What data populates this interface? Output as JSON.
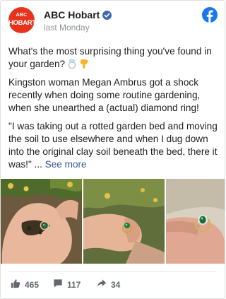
{
  "post": {
    "page_name": "ABC Hobart",
    "avatar": {
      "line1": "ABC",
      "line2": "HOBART"
    },
    "timestamp": "last Monday",
    "text": {
      "question": "What's the most surprising thing you've found in your garden?",
      "story": "Kingston woman Megan Ambrus got a shock recently when doing some routine gardening, when she unearthed a (actual) diamond ring!",
      "quote": "\"I was taking out a rotted garden bed and moving the soil to use elsewhere and when I dug down into the original clay soil beneath the bed, there it was!\" ...",
      "see_more": "See more"
    },
    "icons": {
      "verified": "verified-badge-icon",
      "facebook": "facebook-logo-icon",
      "ring_emoji": "ring-emoji-icon",
      "pointing_emoji": "pointing-down-emoji-icon"
    },
    "stats": {
      "likes": "465",
      "comments": "117",
      "shares": "34"
    },
    "colors": {
      "avatar": "#e8331c",
      "facebook": "#1877f2",
      "link": "#385898",
      "muted": "#616770"
    }
  }
}
